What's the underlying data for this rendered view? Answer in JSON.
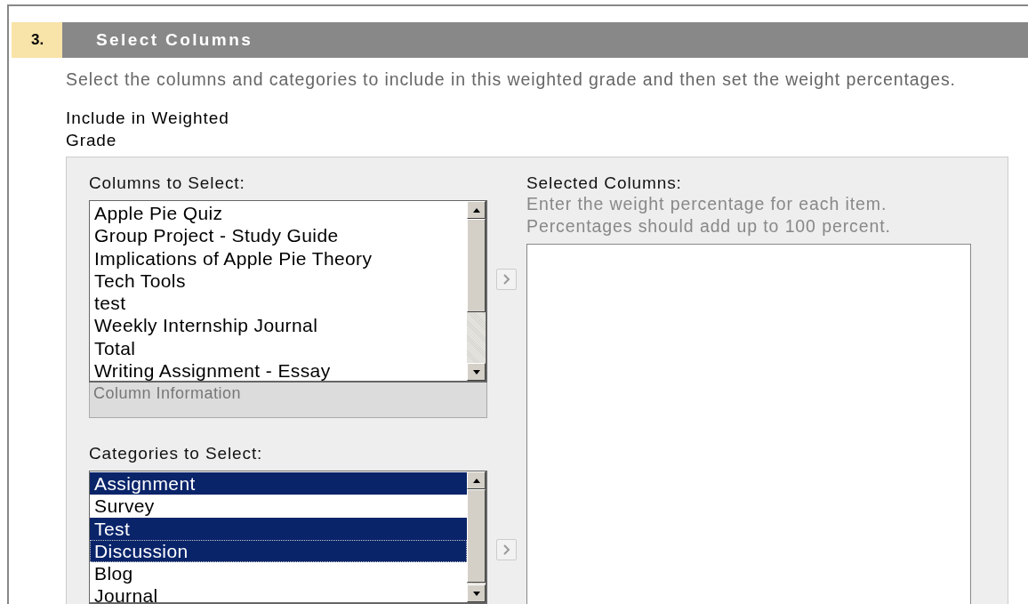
{
  "step": {
    "number": "3.",
    "title": "Select Columns"
  },
  "instructions": "Select the columns and categories to include in this weighted grade and then set the weight percentages.",
  "include_label": "Include in Weighted Grade",
  "columns_list": {
    "label": "Columns to Select:",
    "info": "Column Information",
    "items": [
      {
        "text": "Apple Pie Quiz",
        "selected": false
      },
      {
        "text": "Group Project - Study Guide",
        "selected": false
      },
      {
        "text": "Implications of Apple Pie Theory",
        "selected": false
      },
      {
        "text": "Tech Tools",
        "selected": false
      },
      {
        "text": "test",
        "selected": false
      },
      {
        "text": "Weekly Internship Journal",
        "selected": false
      },
      {
        "text": "Total",
        "selected": false
      },
      {
        "text": "Writing Assignment - Essay",
        "selected": false
      }
    ]
  },
  "categories_list": {
    "label": "Categories to Select:",
    "items": [
      {
        "text": "Assignment",
        "selected": true,
        "focused": false
      },
      {
        "text": "Survey",
        "selected": false,
        "focused": false
      },
      {
        "text": "Test",
        "selected": true,
        "focused": false
      },
      {
        "text": "Discussion",
        "selected": true,
        "focused": true
      },
      {
        "text": "Blog",
        "selected": false,
        "focused": false
      },
      {
        "text": "Journal",
        "selected": false,
        "focused": false
      }
    ]
  },
  "selected_columns": {
    "label": "Selected Columns:",
    "hint_lines": [
      "Enter the weight percentage for each item.",
      "Percentages should add up to 100 percent."
    ]
  }
}
